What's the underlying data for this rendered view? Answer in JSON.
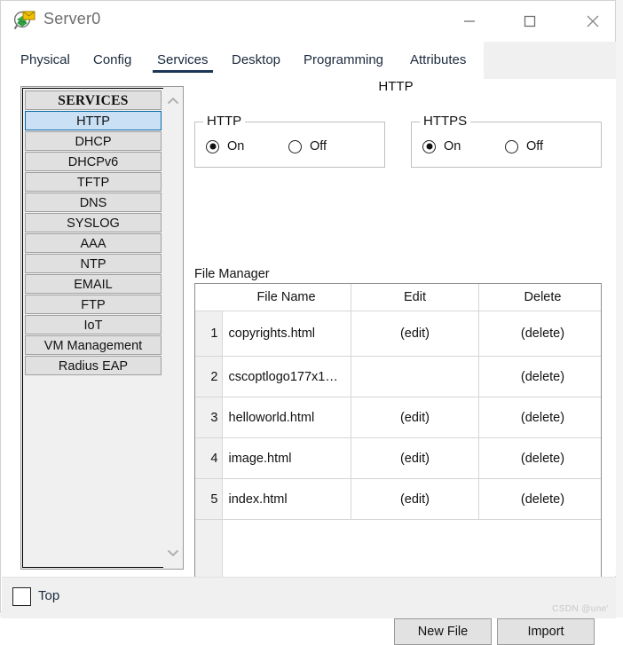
{
  "window": {
    "title": "Server0",
    "icon": "server-device-icon",
    "controls": {
      "minimize": "minimize-icon",
      "maximize": "maximize-icon",
      "close": "close-icon"
    }
  },
  "tabs": [
    {
      "label": "Physical",
      "active": false
    },
    {
      "label": "Config",
      "active": false
    },
    {
      "label": "Services",
      "active": true
    },
    {
      "label": "Desktop",
      "active": false
    },
    {
      "label": "Programming",
      "active": false
    },
    {
      "label": "Attributes",
      "active": false
    }
  ],
  "sidebar": {
    "header": "SERVICES",
    "items": [
      {
        "label": "HTTP",
        "selected": true
      },
      {
        "label": "DHCP",
        "selected": false
      },
      {
        "label": "DHCPv6",
        "selected": false
      },
      {
        "label": "TFTP",
        "selected": false
      },
      {
        "label": "DNS",
        "selected": false
      },
      {
        "label": "SYSLOG",
        "selected": false
      },
      {
        "label": "AAA",
        "selected": false
      },
      {
        "label": "NTP",
        "selected": false
      },
      {
        "label": "EMAIL",
        "selected": false
      },
      {
        "label": "FTP",
        "selected": false
      },
      {
        "label": "IoT",
        "selected": false
      },
      {
        "label": "VM Management",
        "selected": false
      },
      {
        "label": "Radius EAP",
        "selected": false
      }
    ],
    "scroll_up": "chevron-up-icon",
    "scroll_down": "chevron-down-icon"
  },
  "main": {
    "title": "HTTP",
    "http_group": {
      "legend": "HTTP",
      "on_label": "On",
      "off_label": "Off",
      "selected": "On"
    },
    "https_group": {
      "legend": "HTTPS",
      "on_label": "On",
      "off_label": "Off",
      "selected": "On"
    },
    "file_manager": {
      "label": "File Manager",
      "columns": [
        "",
        "File Name",
        "Edit",
        "Delete"
      ],
      "rows": [
        {
          "num": "1",
          "name": "copyrights.html",
          "edit": "(edit)",
          "delete": "(delete)"
        },
        {
          "num": "2",
          "name": "cscoptlogo177x1…",
          "edit": "",
          "delete": "(delete)"
        },
        {
          "num": "3",
          "name": "helloworld.html",
          "edit": "(edit)",
          "delete": "(delete)"
        },
        {
          "num": "4",
          "name": "image.html",
          "edit": "(edit)",
          "delete": "(delete)"
        },
        {
          "num": "5",
          "name": "index.html",
          "edit": "(edit)",
          "delete": "(delete)"
        }
      ]
    },
    "buttons": {
      "new_file": "New File",
      "import": "Import"
    }
  },
  "footer": {
    "top_label": "Top",
    "top_checked": false,
    "watermark": "CSDN @une'"
  },
  "colors": {
    "accent_tab_underline": "#1d3557",
    "selected_item_bg": "#c9e0f5",
    "selected_item_border": "#0b6aa8",
    "button_bg": "#e2e2e2",
    "panel_bg": "#f0f0f0"
  }
}
